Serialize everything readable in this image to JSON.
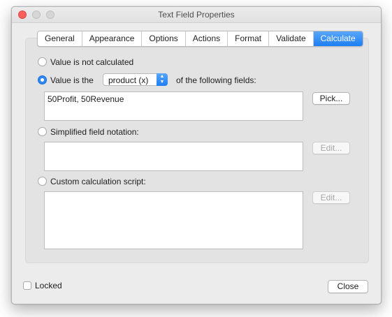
{
  "window": {
    "title": "Text Field Properties"
  },
  "tabs": [
    {
      "label": "General"
    },
    {
      "label": "Appearance"
    },
    {
      "label": "Options"
    },
    {
      "label": "Actions"
    },
    {
      "label": "Format"
    },
    {
      "label": "Validate"
    },
    {
      "label": "Calculate",
      "active": true
    }
  ],
  "calc": {
    "option_not_calculated": "Value is not calculated",
    "option_value_is_the": "Value is the",
    "operation_selected": "product (x)",
    "of_following_fields": "of the following fields:",
    "fields_value": "50Profit, 50Revenue",
    "pick_button": "Pick...",
    "option_simplified": "Simplified field notation:",
    "simplified_value": "",
    "edit_button_1": "Edit...",
    "option_custom": "Custom calculation script:",
    "custom_value": "",
    "edit_button_2": "Edit...",
    "selected_option": "value_is_the"
  },
  "footer": {
    "locked_label": "Locked",
    "locked_checked": false,
    "close_button": "Close"
  },
  "colors": {
    "accent": "#1d7ef5",
    "close_light": "#fc605c"
  },
  "icons": {
    "popup_arrows": "up-down-chevron-icon"
  }
}
